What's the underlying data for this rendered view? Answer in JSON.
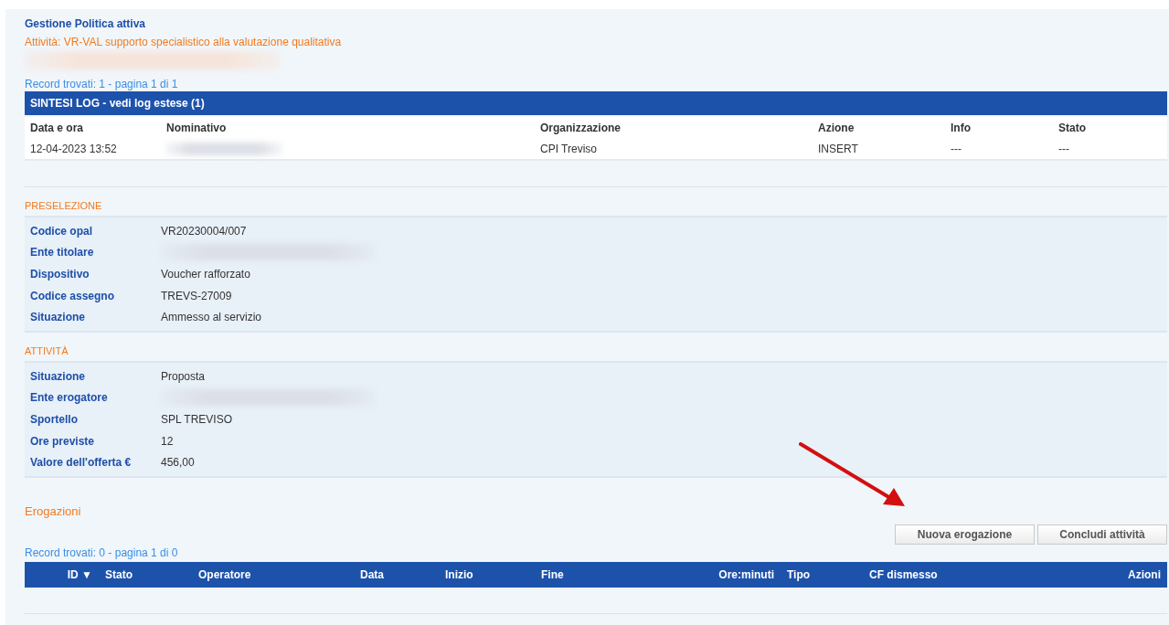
{
  "title": "Gestione Politica attiva",
  "subtitle": "Attività: VR-VAL supporto specialistico alla valutazione qualitativa",
  "subtitle_redacted": true,
  "log": {
    "record_info": "Record trovati: 1 - pagina 1 di 1",
    "header": "SINTESI LOG - vedi log estese (1)",
    "columns": [
      "Data e ora",
      "Nominativo",
      "Organizzazione",
      "Azione",
      "Info",
      "Stato"
    ],
    "rows": [
      {
        "cells": [
          {
            "text": "12-04-2023 13:52"
          },
          {
            "redacted": true
          },
          {
            "text": "CPI Treviso"
          },
          {
            "text": "INSERT"
          },
          {
            "text": "---"
          },
          {
            "text": "---"
          }
        ]
      }
    ]
  },
  "sections": [
    {
      "title": "PRESELEZIONE",
      "rows": [
        {
          "label": "Codice opal",
          "value": "VR20230004/007"
        },
        {
          "label": "Ente titolare",
          "redacted": true
        },
        {
          "label": "Dispositivo",
          "value": "Voucher rafforzato"
        },
        {
          "label": "Codice assegno",
          "value": "TREVS-27009"
        },
        {
          "label": "Situazione",
          "value": "Ammesso al servizio"
        }
      ]
    },
    {
      "title": "ATTIVITÀ",
      "rows": [
        {
          "label": "Situazione",
          "value": "Proposta"
        },
        {
          "label": "Ente erogatore",
          "redacted": true
        },
        {
          "label": "Sportello",
          "value": "SPL TREVISO"
        },
        {
          "label": "Ore previste",
          "value": "12"
        },
        {
          "label": "Valore dell'offerta €",
          "value": "456,00"
        }
      ]
    }
  ],
  "erogazioni": {
    "title": "Erogazioni",
    "buttons": [
      "Nuova erogazione",
      "Concludi attività"
    ],
    "record_info": "Record trovati: 0 - pagina 1 di 0",
    "columns": [
      "ID ▼",
      "Stato",
      "Operatore",
      "Data",
      "Inizio",
      "Fine",
      "Ore:minuti",
      "Tipo",
      "CF dismesso",
      "Azioni"
    ]
  },
  "annotation_arrow": true
}
